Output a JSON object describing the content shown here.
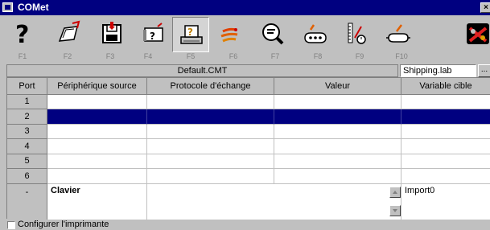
{
  "window": {
    "title": "COMet",
    "close_glyph": "×"
  },
  "toolbar": {
    "buttons": [
      {
        "icon": "help-icon",
        "key": "F1"
      },
      {
        "icon": "open-folder-icon",
        "key": "F2"
      },
      {
        "icon": "save-disk-icon",
        "key": "F3"
      },
      {
        "icon": "unknown-document-icon",
        "key": "F4"
      },
      {
        "icon": "printer-help-icon",
        "key": "F5",
        "pressed": true
      },
      {
        "icon": "send-data-icon",
        "key": "F6"
      },
      {
        "icon": "magnifier-icon",
        "key": "F7"
      },
      {
        "icon": "serial-port-icon",
        "key": "F8"
      },
      {
        "icon": "ruler-timer-icon",
        "key": "F9"
      },
      {
        "icon": "connector-icon",
        "key": "F10"
      },
      {
        "icon": "exit-icon",
        "key": ""
      }
    ]
  },
  "file": {
    "name": "Default.CMT",
    "target": "Shipping.lab",
    "browse": "..."
  },
  "grid": {
    "headers": [
      "Port",
      "Périphérique source",
      "Protocole d'échange",
      "Valeur",
      "Variable cible"
    ],
    "rows": [
      "1",
      "2",
      "3",
      "4",
      "5",
      "6"
    ],
    "selected_row": 2,
    "detail": {
      "port": "-",
      "source": "Clavier",
      "target": "Import0"
    }
  },
  "footer": {
    "checkbox_label": "Configurer l'imprimante",
    "checked": false
  },
  "colors": {
    "titlebar": "#000080",
    "selection": "#000080",
    "face": "#c0c0c0"
  }
}
